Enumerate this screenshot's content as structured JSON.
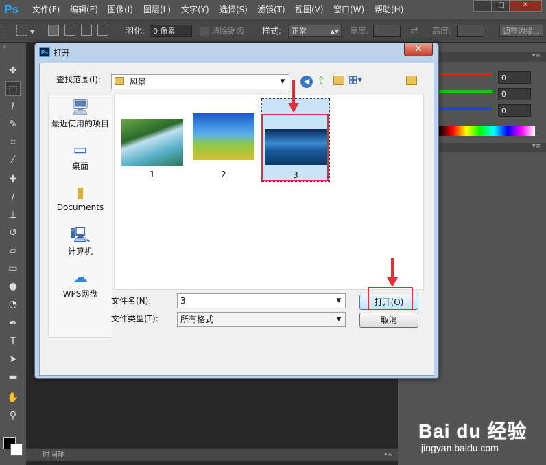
{
  "app": {
    "logo_text": "Ps"
  },
  "menu": [
    "文件(F)",
    "编辑(E)",
    "图像(I)",
    "图层(L)",
    "文字(Y)",
    "选择(S)",
    "滤镜(T)",
    "视图(V)",
    "窗口(W)",
    "帮助(H)"
  ],
  "window_controls": {
    "minimize": "—",
    "maximize": "□",
    "close": "✕"
  },
  "options": {
    "feather_label": "羽化:",
    "feather_value": "0 像素",
    "antialias_label": "消除锯齿",
    "style_label": "样式:",
    "style_value": "正常",
    "width_label": "宽度:",
    "height_label": "高度:",
    "refine_edge": "调整边缘..."
  },
  "right_panel": {
    "values": [
      "0",
      "0",
      "0"
    ],
    "colors": {
      "red": "#e02020",
      "green": "#20c020",
      "blue": "#2040e0"
    }
  },
  "timeline": {
    "label": "时间轴"
  },
  "dialog": {
    "logo": "Ps",
    "title": "打开",
    "close": "✕",
    "lookin_label": "查找范围(I):",
    "lookin_value": "风景",
    "places": [
      {
        "label": "最近使用的项目",
        "icon": "recent-items-icon"
      },
      {
        "label": "桌面",
        "icon": "desktop-icon"
      },
      {
        "label": "Documents",
        "icon": "folder-icon"
      },
      {
        "label": "计算机",
        "icon": "computer-icon"
      },
      {
        "label": "WPS网盘",
        "icon": "cloud-icon"
      }
    ],
    "files": [
      {
        "name": "1",
        "selected": false
      },
      {
        "name": "2",
        "selected": false
      },
      {
        "name": "3",
        "selected": true
      }
    ],
    "filename_label": "文件名(N):",
    "filename_value": "3",
    "filetype_label": "文件类型(T):",
    "filetype_value": "所有格式",
    "open_button": "打开(O)",
    "cancel_button": "取消"
  },
  "watermark": {
    "brand": "Bai du 经验",
    "url": "jingyan.baidu.com"
  },
  "colors": {
    "accent_red": "#e0303a",
    "selection": "#cce4f7",
    "ps_blue": "#31a8ff"
  }
}
